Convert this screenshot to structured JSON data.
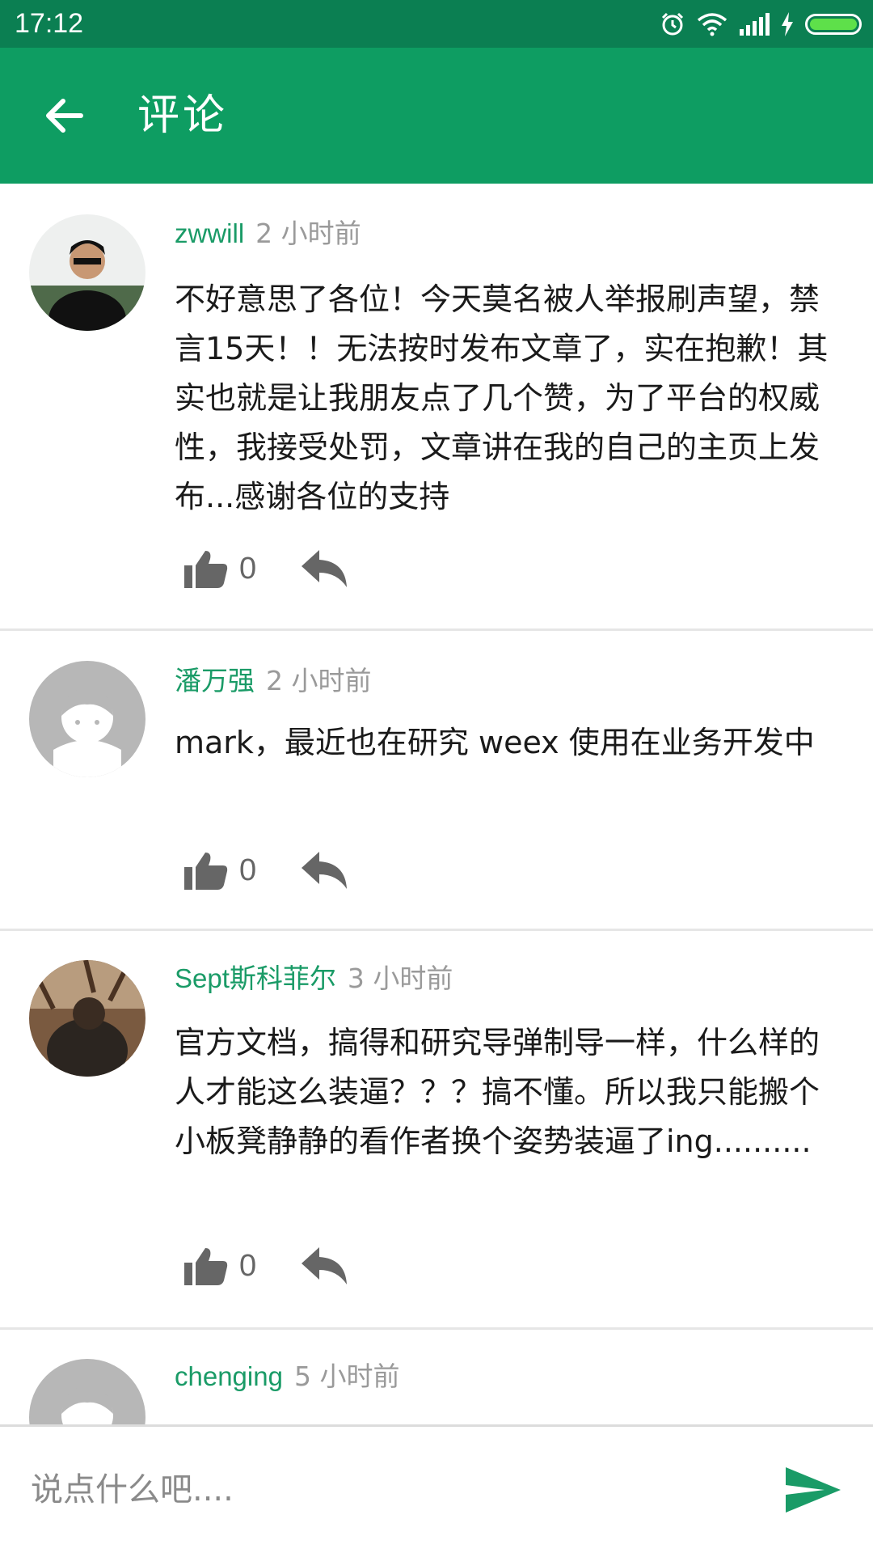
{
  "status_bar": {
    "time": "17:12"
  },
  "app_bar": {
    "title": "评论"
  },
  "comments": [
    {
      "author": "zwwill",
      "time": "2 小时前",
      "content": "不好意思了各位！今天莫名被人举报刷声望，禁言15天！！无法按时发布文章了，实在抱歉！其实也就是让我朋友点了几个赞，为了平台的权威性，我接受处罚，文章讲在我的自己的主页上发布...感谢各位的支持",
      "likes": "0"
    },
    {
      "author": "潘万强",
      "time": "2 小时前",
      "content": "mark，最近也在研究 weex 使用在业务开发中",
      "likes": "0"
    },
    {
      "author": "Sept斯科菲尔",
      "time": "3 小时前",
      "content": "官方文档，搞得和研究导弹制导一样，什么样的人才能这么装逼？？？搞不懂。所以我只能搬个小板凳静静的看作者换个姿势装逼了ing..........",
      "likes": "0"
    },
    {
      "author": "chenging",
      "time": "5 小时前"
    }
  ],
  "comment_input": {
    "placeholder": "说点什么吧...."
  },
  "colors": {
    "status_bar": "#0b7f52",
    "app_bar": "#0e9d62",
    "accent": "#1a9b67"
  }
}
